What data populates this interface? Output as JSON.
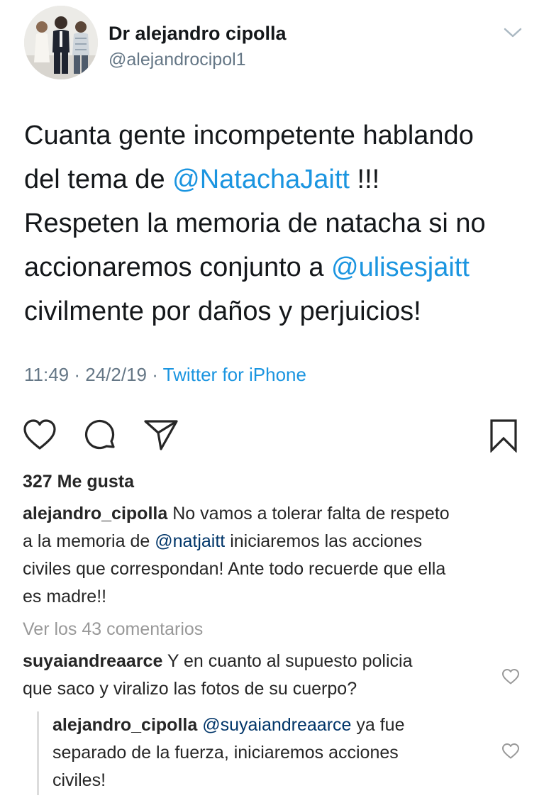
{
  "tweet": {
    "display_name": "Dr alejandro cipolla",
    "handle": "@alejandrocipol1",
    "text_lines": [
      [
        {
          "t": "Cuanta gente incompetente hablando",
          "m": false
        }
      ],
      [
        {
          "t": "del tema de ",
          "m": false
        },
        {
          "t": "@NatachaJaitt",
          "m": true
        },
        {
          "t": " !!!",
          "m": false
        }
      ],
      [
        {
          "t": "Respeten la memoria de natacha si no",
          "m": false
        }
      ],
      [
        {
          "t": "accionaremos conjunto a ",
          "m": false
        },
        {
          "t": "@ulisesjaitt",
          "m": true
        }
      ],
      [
        {
          "t": "civilmente por daños y perjuicios!",
          "m": false
        }
      ]
    ],
    "time": "11:49",
    "date": "24/2/19",
    "source": "Twitter for iPhone",
    "separator": " · "
  },
  "post": {
    "likes_label": "327 Me gusta",
    "caption": {
      "username": "alejandro_cipolla",
      "line1": " No vamos a tolerar falta de respeto",
      "line2_pre": "a la memoria de ",
      "line2_mention": "@natjaitt",
      "line2_post": " iniciaremos las acciones",
      "line3": "civiles que correspondan! Ante todo recuerde que ella",
      "line4": "es madre!!"
    },
    "view_comments": "Ver los 43 comentarios",
    "comment": {
      "username": "suyaiandreaarce",
      "line1": " Y en cuanto al supuesto policia",
      "line2": "que saco y viralizo las fotos de su cuerpo?"
    },
    "reply": {
      "username": "alejandro_cipolla",
      "mention": "@suyaiandreaarce",
      "line1_post": " ya fue",
      "line2": "separado de la fuerza, iniciaremos acciones",
      "line3": "civiles!"
    }
  },
  "icons": {
    "tweet_menu": "chevron-down-icon",
    "like": "heart-icon",
    "comment": "comment-icon",
    "share": "paper-plane-icon",
    "save": "bookmark-icon",
    "comment_like": "heart-icon"
  },
  "colors": {
    "twitter_link": "#1b95e0",
    "twitter_secondary": "#657786",
    "instagram_text": "#262626",
    "instagram_muted": "#999999"
  }
}
